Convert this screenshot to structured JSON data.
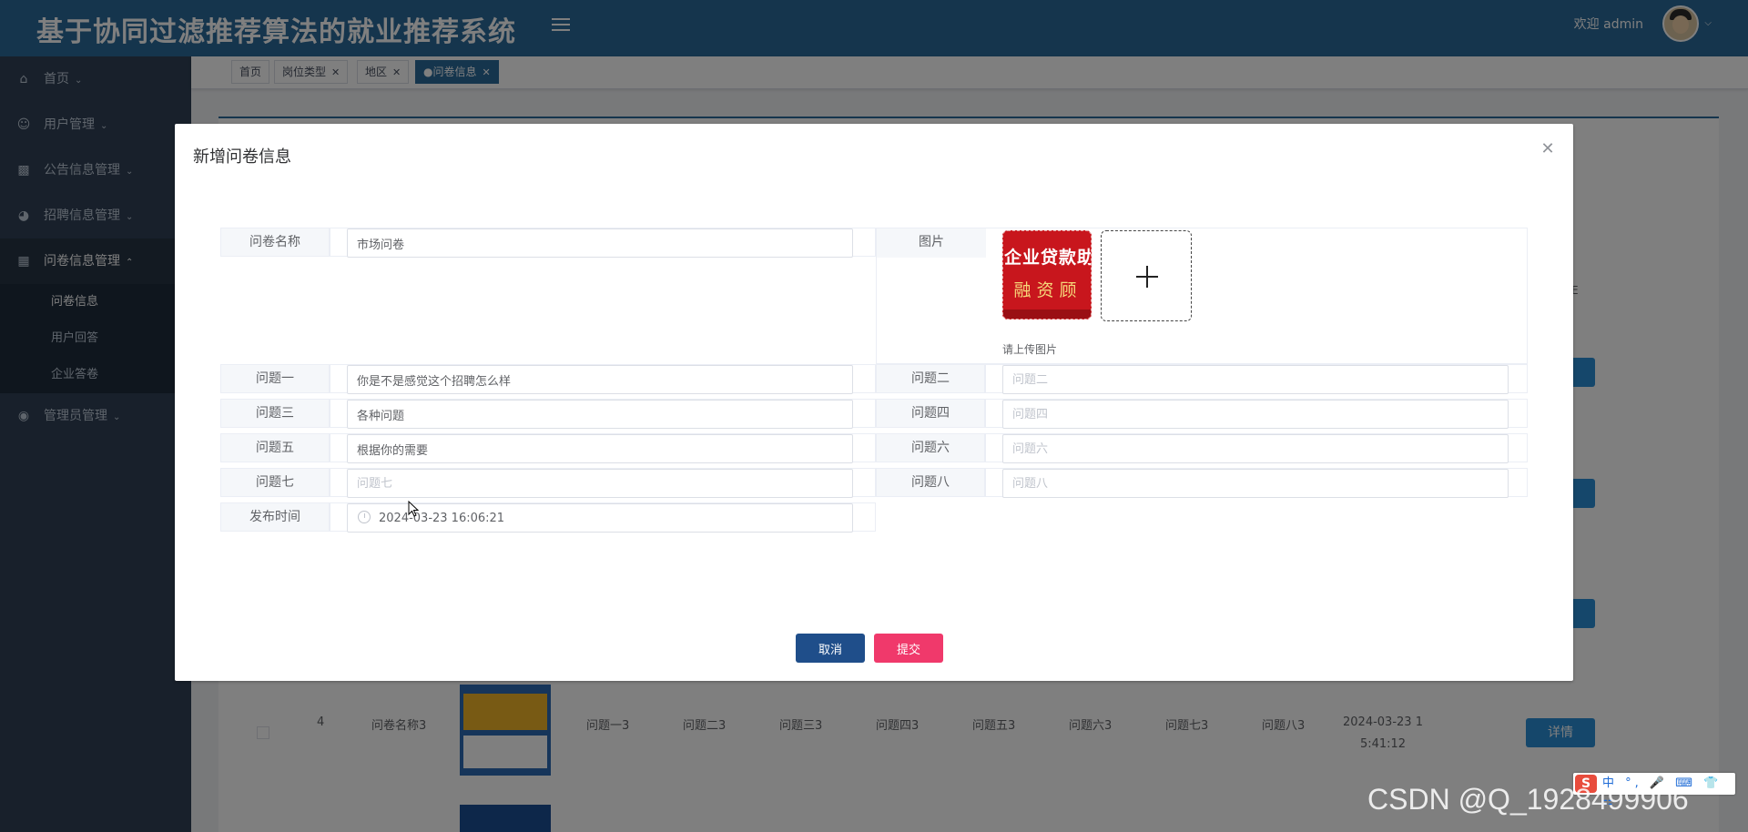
{
  "header": {
    "app_title": "基于协同过滤推荐算法的就业推荐系统",
    "welcome": "欢迎 admin"
  },
  "sidebar": {
    "items": [
      {
        "label": "首页",
        "icon": "home-icon"
      },
      {
        "label": "用户管理",
        "icon": "user-icon"
      },
      {
        "label": "公告信息管理",
        "icon": "chart-icon"
      },
      {
        "label": "招聘信息管理",
        "icon": "gauge-icon"
      },
      {
        "label": "问卷信息管理",
        "icon": "dashboard-icon",
        "open": true
      },
      {
        "label": "管理员管理",
        "icon": "admin-icon"
      }
    ],
    "submenu": [
      "问卷信息",
      "用户回答",
      "企业答卷"
    ]
  },
  "tabs": [
    {
      "label": "首页",
      "closable": false
    },
    {
      "label": "岗位类型",
      "closable": true
    },
    {
      "label": "地区",
      "closable": true
    },
    {
      "label": "●问卷信息",
      "closable": true,
      "active": true
    }
  ],
  "background_table": {
    "col_e": "E",
    "row": {
      "index": "4",
      "name": "问卷名称3",
      "q1": "问题一3",
      "q2": "问题二3",
      "q3": "问题三3",
      "q4": "问题四3",
      "q5": "问题五3",
      "q6": "问题六3",
      "q7": "问题七3",
      "q8": "问题八3",
      "date_line1": "2024-03-23 1",
      "date_line2": "5:41:12",
      "detail_label": "详情"
    }
  },
  "dialog": {
    "title": "新增问卷信息",
    "fields": {
      "name": {
        "label": "问卷名称",
        "value": "市场问卷"
      },
      "image": {
        "label": "图片",
        "hint": "请上传图片",
        "thumb_line1": "企业贷款助",
        "thumb_line2": "融资顾"
      },
      "q1": {
        "label": "问题一",
        "value": "你是不是感觉这个招聘怎么样",
        "placeholder": "问题一"
      },
      "q2": {
        "label": "问题二",
        "value": "",
        "placeholder": "问题二"
      },
      "q3": {
        "label": "问题三",
        "value": "各种问题",
        "placeholder": "问题三"
      },
      "q4": {
        "label": "问题四",
        "value": "",
        "placeholder": "问题四"
      },
      "q5": {
        "label": "问题五",
        "value": "根据你的需要",
        "placeholder": "问题五"
      },
      "q6": {
        "label": "问题六",
        "value": "",
        "placeholder": "问题六"
      },
      "q7": {
        "label": "问题七",
        "value": "",
        "placeholder": "问题七"
      },
      "q8": {
        "label": "问题八",
        "value": "",
        "placeholder": "问题八"
      },
      "publish_time": {
        "label": "发布时间",
        "value": "2024-03-23 16:06:21"
      }
    },
    "cancel_label": "取消",
    "submit_label": "提交"
  },
  "ime_toolbar": {
    "logo": "S",
    "glyphs": "中 °, 🎤 ⌨ 👕 ⚏"
  },
  "watermark": "CSDN @Q_1928499906"
}
